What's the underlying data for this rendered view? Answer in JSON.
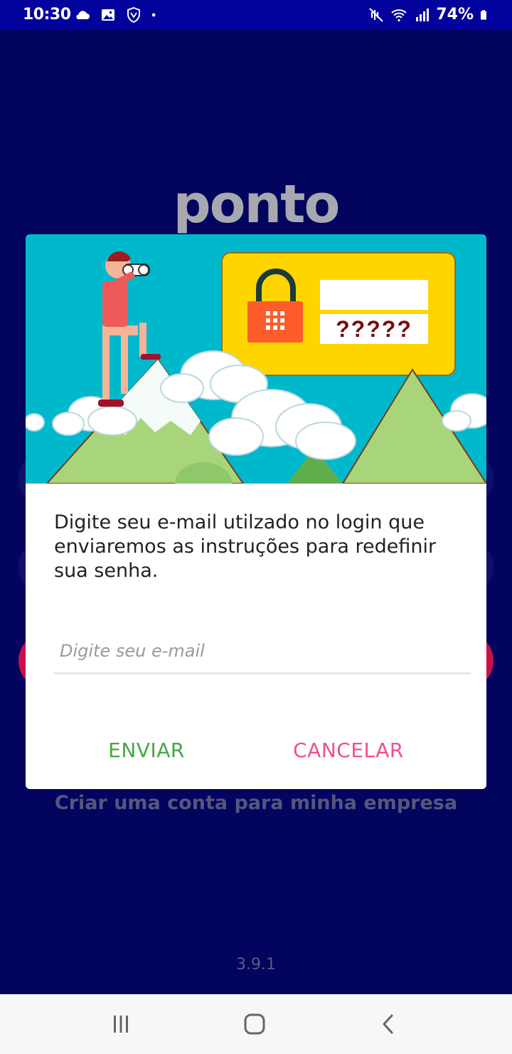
{
  "status_bar": {
    "time": "10:30",
    "battery": "74%",
    "left_icons": [
      "cloud-icon",
      "image-icon",
      "shield-icon",
      "dot-icon"
    ],
    "right_icons": [
      "mute-icon",
      "wifi-icon",
      "signal-icon",
      "battery-icon"
    ]
  },
  "app": {
    "logo": "ponto",
    "create_account_link": "Criar uma conta para minha empresa",
    "version": "3.9.1"
  },
  "dialog": {
    "illustration": {
      "password_hint": "?????",
      "colors": {
        "sky": "#00b8cc",
        "card": "#ffd500",
        "lock": "#ff5c2c",
        "mountain": "#a8d57a"
      }
    },
    "message": "Digite seu e-mail utilzado no login que enviaremos as instruções para redefinir sua senha.",
    "email_input": {
      "placeholder": "Digite seu e-mail",
      "value": ""
    },
    "send_label": "ENVIAR",
    "cancel_label": "CANCELAR",
    "colors": {
      "send": "#43a845",
      "cancel": "#ee4f93"
    }
  },
  "nav_bar": {
    "icons": [
      "recent-apps-icon",
      "home-icon",
      "back-icon"
    ]
  }
}
